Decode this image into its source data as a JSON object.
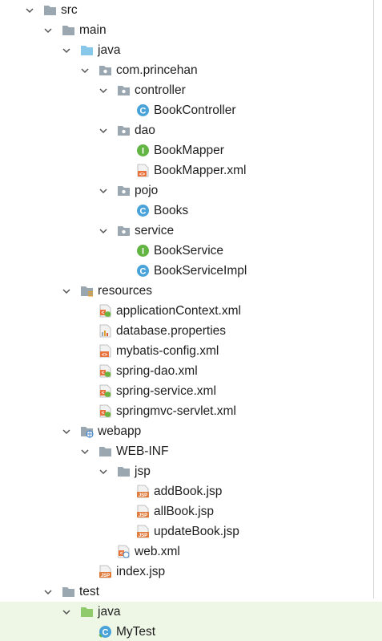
{
  "project_tree": {
    "items": [
      {
        "label": "src",
        "icon": "folder",
        "expandable": true
      },
      {
        "label": "main",
        "icon": "folder",
        "expandable": true
      },
      {
        "label": "java",
        "icon": "source-folder",
        "expandable": true
      },
      {
        "label": "com.princehan",
        "icon": "package",
        "expandable": true
      },
      {
        "label": "controller",
        "icon": "package",
        "expandable": true
      },
      {
        "label": "BookController",
        "icon": "class",
        "expandable": false
      },
      {
        "label": "dao",
        "icon": "package",
        "expandable": true
      },
      {
        "label": "BookMapper",
        "icon": "interface",
        "expandable": false
      },
      {
        "label": "BookMapper.xml",
        "icon": "xml-file",
        "expandable": false
      },
      {
        "label": "pojo",
        "icon": "package",
        "expandable": true
      },
      {
        "label": "Books",
        "icon": "class",
        "expandable": false
      },
      {
        "label": "service",
        "icon": "package",
        "expandable": true
      },
      {
        "label": "BookService",
        "icon": "interface",
        "expandable": false
      },
      {
        "label": "BookServiceImpl",
        "icon": "class",
        "expandable": false
      },
      {
        "label": "resources",
        "icon": "resources-folder",
        "expandable": true
      },
      {
        "label": "applicationContext.xml",
        "icon": "spring-xml",
        "expandable": false
      },
      {
        "label": "database.properties",
        "icon": "properties-file",
        "expandable": false
      },
      {
        "label": "mybatis-config.xml",
        "icon": "xml-file",
        "expandable": false
      },
      {
        "label": "spring-dao.xml",
        "icon": "spring-xml",
        "expandable": false
      },
      {
        "label": "spring-service.xml",
        "icon": "spring-xml",
        "expandable": false
      },
      {
        "label": "springmvc-servlet.xml",
        "icon": "spring-xml",
        "expandable": false
      },
      {
        "label": "webapp",
        "icon": "web-folder",
        "expandable": true
      },
      {
        "label": "WEB-INF",
        "icon": "folder",
        "expandable": true
      },
      {
        "label": "jsp",
        "icon": "folder",
        "expandable": true
      },
      {
        "label": "addBook.jsp",
        "icon": "jsp-file",
        "expandable": false
      },
      {
        "label": "allBook.jsp",
        "icon": "jsp-file",
        "expandable": false
      },
      {
        "label": "updateBook.jsp",
        "icon": "jsp-file",
        "expandable": false
      },
      {
        "label": "web.xml",
        "icon": "web-xml",
        "expandable": false
      },
      {
        "label": "index.jsp",
        "icon": "jsp-file",
        "expandable": false
      },
      {
        "label": "test",
        "icon": "folder",
        "expandable": true
      },
      {
        "label": "java",
        "icon": "test-source-folder",
        "expandable": true
      },
      {
        "label": "MyTest",
        "icon": "test-class",
        "expandable": false
      }
    ]
  },
  "colors": {
    "folder": "#9aa7b0",
    "source_folder": "#87c7ea",
    "test_folder": "#8fcb6b",
    "class_icon": "#4aa3d8",
    "interface_icon": "#62b543",
    "xml_icon": "#e8733d",
    "spring_green": "#6db33f",
    "jsp_icon": "#e07b3c",
    "selection_bg": "#eef7e6"
  }
}
